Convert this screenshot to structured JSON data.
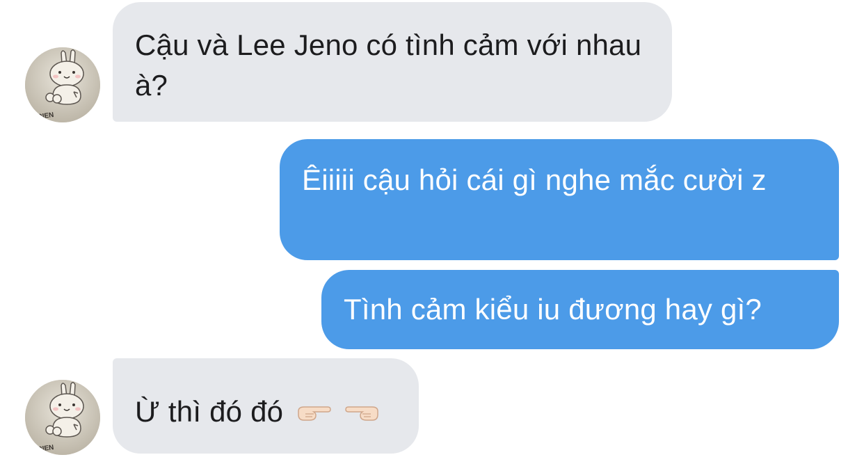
{
  "conversation": {
    "messages": [
      {
        "sender": "them",
        "text": "Cậu và Lee Jeno có tình cảm với nhau à?"
      },
      {
        "sender": "me",
        "text": "Êiiiii cậu hỏi cái gì nghe mắc cười z"
      },
      {
        "sender": "me",
        "text": "Tình cảm kiểu iu đương hay gì?"
      },
      {
        "sender": "them",
        "text": "Ừ thì đó đó",
        "emojis": [
          "pointing-right-emoji",
          "pointing-left-emoji"
        ]
      }
    ]
  },
  "avatar": {
    "icon": "bunny-sticker-icon",
    "caption": "FRIEN"
  },
  "colors": {
    "incoming_bubble": "#e6e8ec",
    "outgoing_bubble": "#4c9be8",
    "incoming_text": "#1c1c1e",
    "outgoing_text": "#ffffff"
  }
}
